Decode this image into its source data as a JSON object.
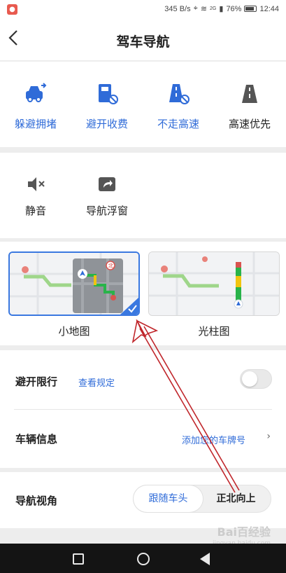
{
  "status_bar": {
    "speed": "345 B/s",
    "network": "2G",
    "battery": "76%",
    "time": "12:44"
  },
  "header": {
    "title": "驾车导航"
  },
  "route_prefs": [
    {
      "label": "躲避拥堵",
      "icon": "car-traffic-icon",
      "active": true
    },
    {
      "label": "避开收费",
      "icon": "toll-avoid-icon",
      "active": true
    },
    {
      "label": "不走高速",
      "icon": "no-highway-icon",
      "active": true
    },
    {
      "label": "高速优先",
      "icon": "highway-icon",
      "active": false
    }
  ],
  "tools": [
    {
      "label": "静音",
      "icon": "mute-icon"
    },
    {
      "label": "导航浮窗",
      "icon": "floating-window-icon"
    }
  ],
  "map_modes": [
    {
      "label": "小地图",
      "selected": true
    },
    {
      "label": "光柱图",
      "selected": false
    }
  ],
  "settings": {
    "avoid_limit_label": "避开限行",
    "avoid_limit_link": "查看规定",
    "avoid_limit_on": false,
    "vehicle_label": "车辆信息",
    "vehicle_link": "添加您的车牌号",
    "view_label": "导航视角",
    "view_options": [
      "跟随车头",
      "正北向上"
    ],
    "view_selected": "跟随车头"
  },
  "watermark": {
    "brand": "Bai百经验",
    "url": "jingyan.baidu.com"
  },
  "colors": {
    "accent": "#2f6bd8",
    "annotation_arrow": "#c0262b"
  }
}
